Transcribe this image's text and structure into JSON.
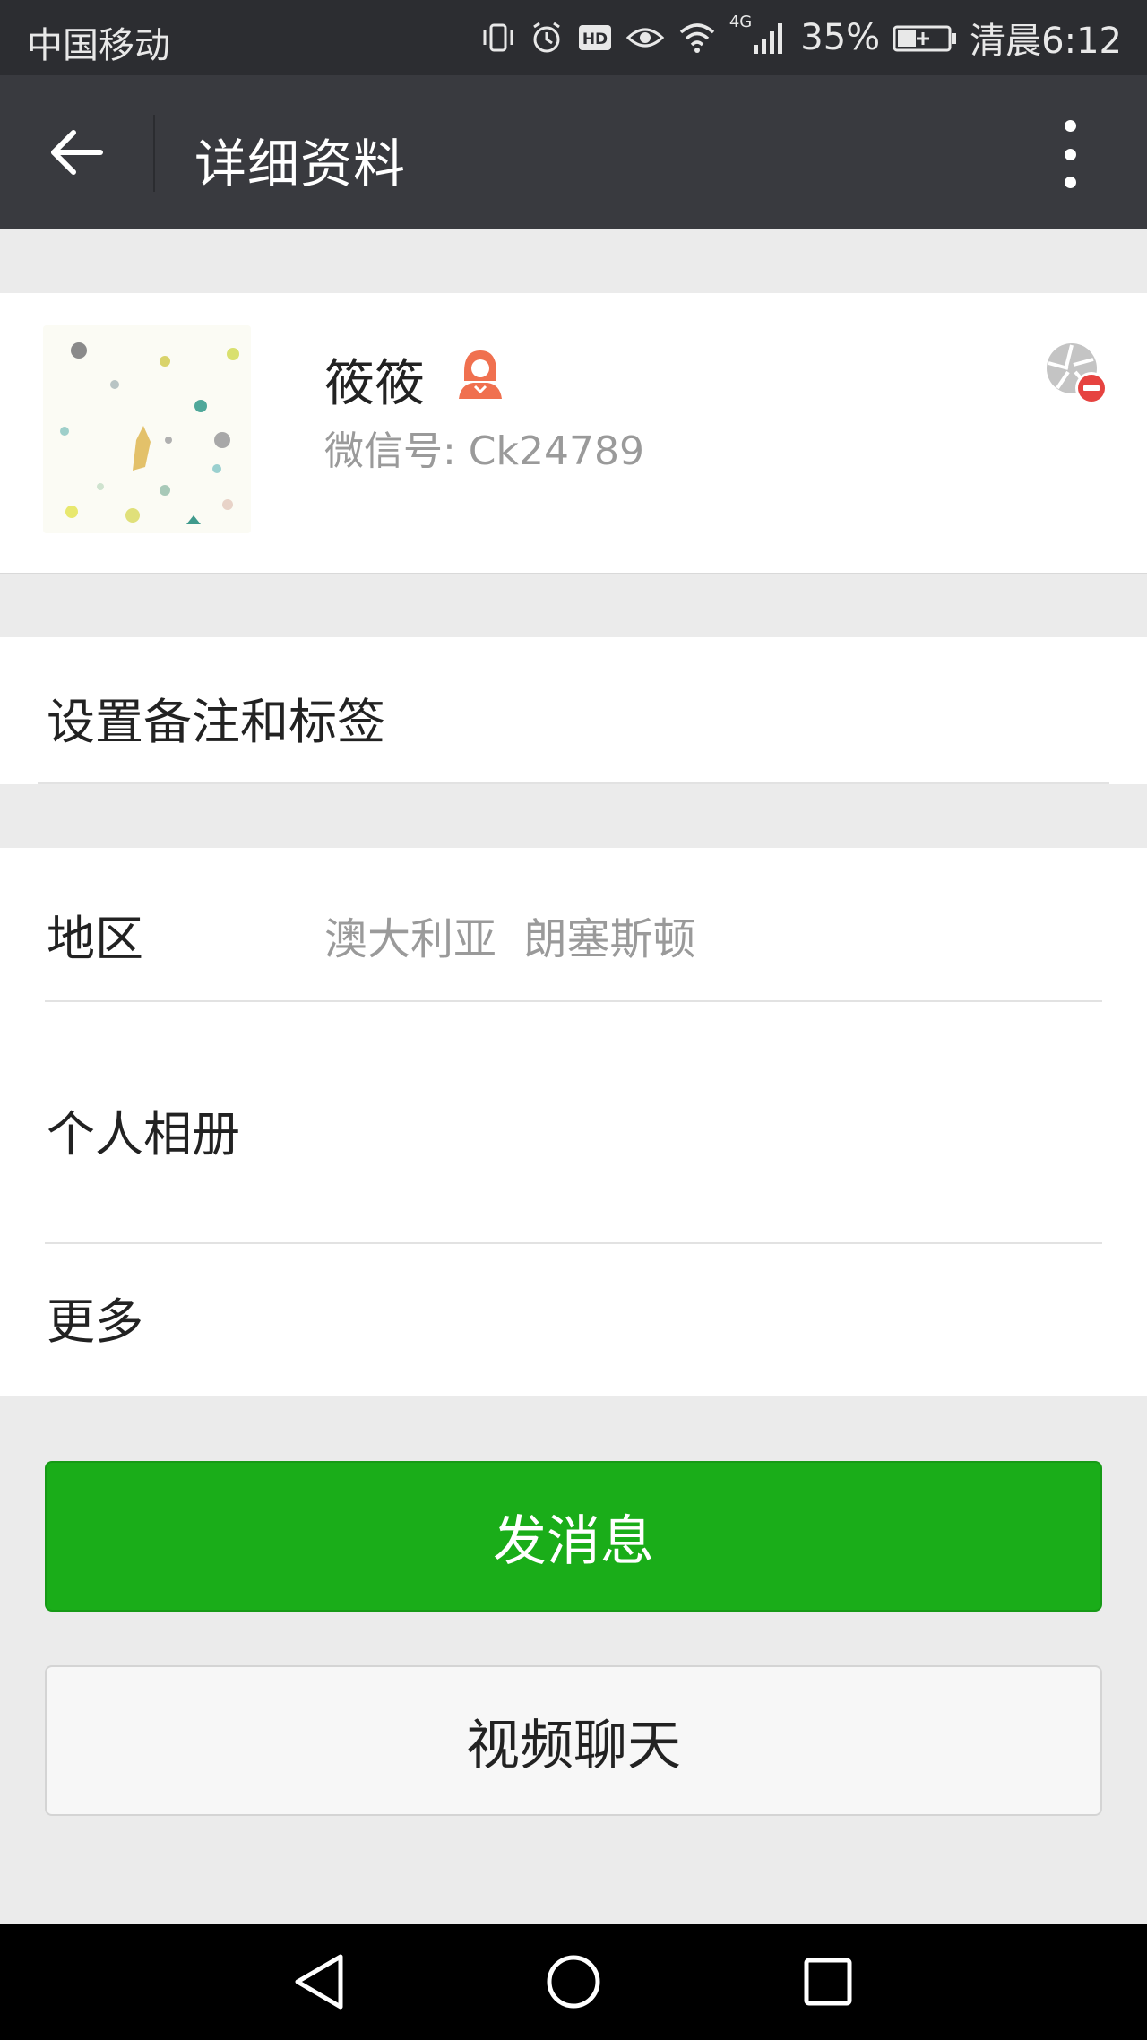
{
  "status_bar": {
    "carrier": "中国移动",
    "network": "4G",
    "battery": "35%",
    "time": "清晨6:12",
    "icons": [
      "vibrate-icon",
      "alarm-icon",
      "hd-icon",
      "eye-icon",
      "wifi-icon",
      "signal-icon",
      "battery-icon"
    ]
  },
  "title_bar": {
    "title": "详细资料",
    "back_icon": "back-arrow-icon",
    "more_icon": "more-vertical-icon"
  },
  "profile": {
    "nickname": "筱筱",
    "wechat_id": "微信号: Ck24789",
    "gender": "female",
    "gender_icon": "female-icon",
    "moments_block_icon": "moments-blocked-icon"
  },
  "rows": {
    "remark_label": "设置备注和标签",
    "region_label": "地区",
    "region_value": "澳大利亚  朗塞斯顿",
    "album_label": "个人相册",
    "more_label": "更多"
  },
  "buttons": {
    "send_message": "发消息",
    "video_chat": "视频聊天"
  },
  "nav_bar": {
    "icons": [
      "nav-back-icon",
      "nav-home-icon",
      "nav-recents-icon"
    ]
  },
  "colors": {
    "status_bar": "#2c2d31",
    "title_bar": "#393a3f",
    "page_background": "#ebebeb",
    "primary_green": "#1aad19",
    "female_icon": "#f0704f"
  }
}
